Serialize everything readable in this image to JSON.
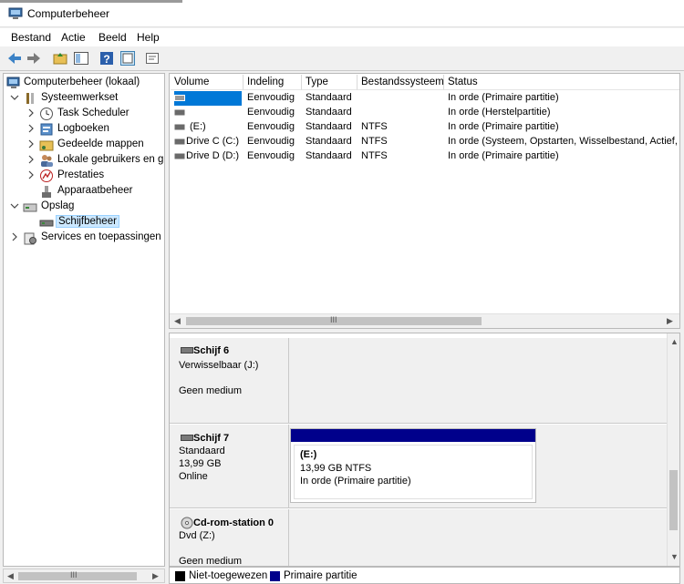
{
  "window": {
    "title": "Computerbeheer"
  },
  "menu": [
    "Bestand",
    "Actie",
    "Beeld",
    "Help"
  ],
  "tree": {
    "root": "Computerbeheer (lokaal)",
    "systeemwerkset": "Systeemwerkset",
    "task_scheduler": "Task Scheduler",
    "logboeken": "Logboeken",
    "gedeelde_mappen": "Gedeelde mappen",
    "lokale_gebruikers": "Lokale gebruikers en gr",
    "prestaties": "Prestaties",
    "apparaatbeheer": "Apparaatbeheer",
    "opslag": "Opslag",
    "schijfbeheer": "Schijfbeheer",
    "services": "Services en toepassingen"
  },
  "volume_list": {
    "columns": [
      "Volume",
      "Indeling",
      "Type",
      "Bestandssysteem",
      "Status"
    ],
    "rows": [
      {
        "volume": "",
        "indeling": "Eenvoudig",
        "type": "Standaard",
        "fs": "",
        "status": "In orde (Primaire partitie)"
      },
      {
        "volume": "",
        "indeling": "Eenvoudig",
        "type": "Standaard",
        "fs": "",
        "status": "In orde (Herstelpartitie)"
      },
      {
        "volume": "(E:)",
        "indeling": "Eenvoudig",
        "type": "Standaard",
        "fs": "NTFS",
        "status": "In orde (Primaire partitie)"
      },
      {
        "volume": "Drive C (C:)",
        "indeling": "Eenvoudig",
        "type": "Standaard",
        "fs": "NTFS",
        "status": "In orde (Systeem, Opstarten, Wisselbestand, Actief,"
      },
      {
        "volume": "Drive D (D:)",
        "indeling": "Eenvoudig",
        "type": "Standaard",
        "fs": "NTFS",
        "status": "In orde (Primaire partitie)"
      }
    ],
    "scroll_grip": "III"
  },
  "disks": [
    {
      "title": "Schijf 6",
      "line1": "Verwisselbaar (J:)",
      "line2": "",
      "line3": "Geen medium"
    },
    {
      "title": "Schijf 7",
      "line1": "Standaard",
      "line2": "13,99 GB",
      "line3": "Online",
      "partition": {
        "name": "(E:)",
        "size": "13,99 GB NTFS",
        "status": "In orde (Primaire partitie)"
      }
    },
    {
      "title": "Cd-rom-station 0",
      "line1": "Dvd (Z:)",
      "line2": "",
      "line3": "Geen medium"
    }
  ],
  "legend": [
    {
      "label": "Niet-toegewezen",
      "color": "#000000"
    },
    {
      "label": "Primaire partitie",
      "color": "#00008b"
    }
  ],
  "tree_scroll_grip": "III",
  "colors": {
    "selection": "#0078d7",
    "partition_bar": "#00008b"
  }
}
